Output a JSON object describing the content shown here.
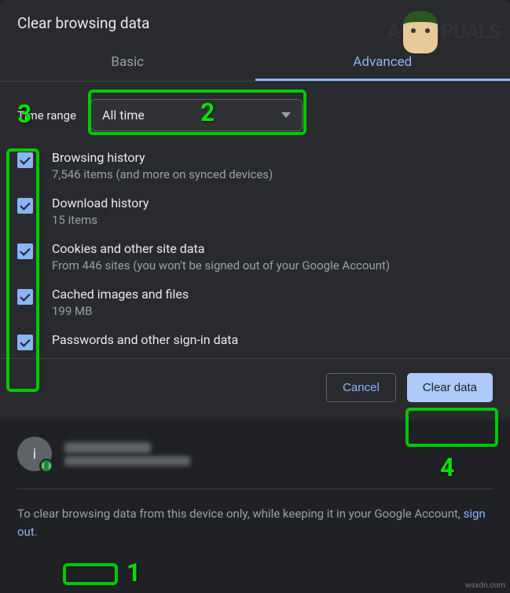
{
  "dialog": {
    "title": "Clear browsing data",
    "tabs": {
      "basic": "Basic",
      "advanced": "Advanced"
    }
  },
  "time_range": {
    "label": "Time range",
    "selected": "All time"
  },
  "options": [
    {
      "title": "Browsing history",
      "sub": "7,546 items (and more on synced devices)"
    },
    {
      "title": "Download history",
      "sub": "15 items"
    },
    {
      "title": "Cookies and other site data",
      "sub": "From 446 sites (you won't be signed out of your Google Account)"
    },
    {
      "title": "Cached images and files",
      "sub": "199 MB"
    },
    {
      "title": "Passwords and other sign-in data",
      "sub": ""
    }
  ],
  "buttons": {
    "cancel": "Cancel",
    "clear": "Clear data"
  },
  "account": {
    "initial": "i"
  },
  "footer": {
    "text_before": "To clear browsing data from this device only, while keeping it in your Google Account, ",
    "link": "sign out",
    "text_after": "."
  },
  "annotations": {
    "n1": "1",
    "n2": "2",
    "n3": "3",
    "n4": "4"
  },
  "watermark": {
    "prefix": "A",
    "suffix": "PUALS"
  },
  "credit": "wsxdn.com"
}
